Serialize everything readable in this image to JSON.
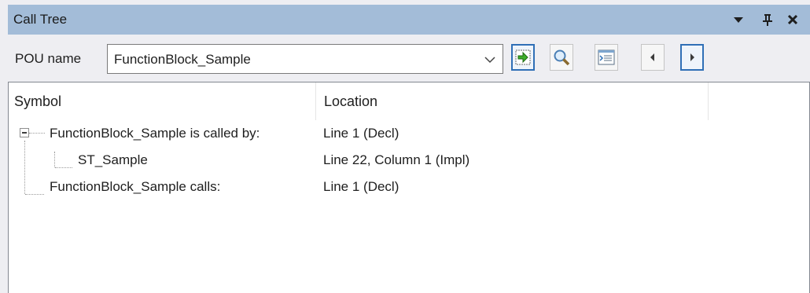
{
  "window": {
    "title": "Call Tree"
  },
  "title_buttons": {
    "dropdown_icon": "chevron-down-icon",
    "pin_icon": "pin-icon",
    "close_icon": "close-icon"
  },
  "toolbar": {
    "pou_label": "POU name",
    "pou_value": "FunctionBlock_Sample",
    "buttons": [
      "go-arrow-icon",
      "magnifier-icon",
      "browse-icon",
      "triangle-left-icon",
      "triangle-right-icon"
    ]
  },
  "columns": {
    "symbol": "Symbol",
    "location": "Location"
  },
  "tree": [
    {
      "symbol": "FunctionBlock_Sample is called by:",
      "location": "Line 1 (Decl)",
      "expanded": true
    },
    {
      "symbol": "ST_Sample",
      "location": "Line 22, Column 1 (Impl)"
    },
    {
      "symbol": "FunctionBlock_Sample calls:",
      "location": "Line 1 (Decl)"
    }
  ],
  "colors": {
    "titlebar": "#a3bcd8",
    "active_button_border": "#2f6fb6",
    "background": "#eeeef2"
  }
}
